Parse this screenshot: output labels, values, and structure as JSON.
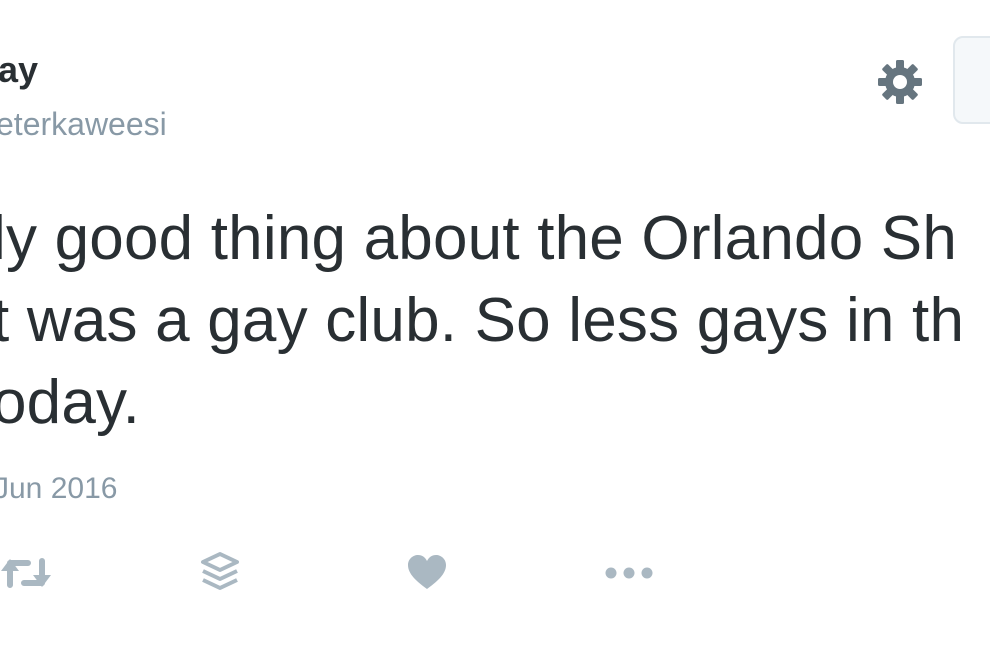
{
  "tweet": {
    "display_name": "ay",
    "handle": "eterkaweesi",
    "text_lines": [
      "ly good thing about the Orlando Sh",
      "t was a gay club. So less gays in th",
      "oday."
    ],
    "timestamp": "Jun 2016"
  },
  "icons": {
    "settings": "gear-icon",
    "retweet": "retweet-icon",
    "buffer": "layers-icon",
    "like": "heart-icon",
    "more": "more-dots-icon"
  },
  "colors": {
    "text": "#292f33",
    "muted": "#8899a6",
    "icon": "#aab8c2",
    "gear": "#66757f"
  }
}
